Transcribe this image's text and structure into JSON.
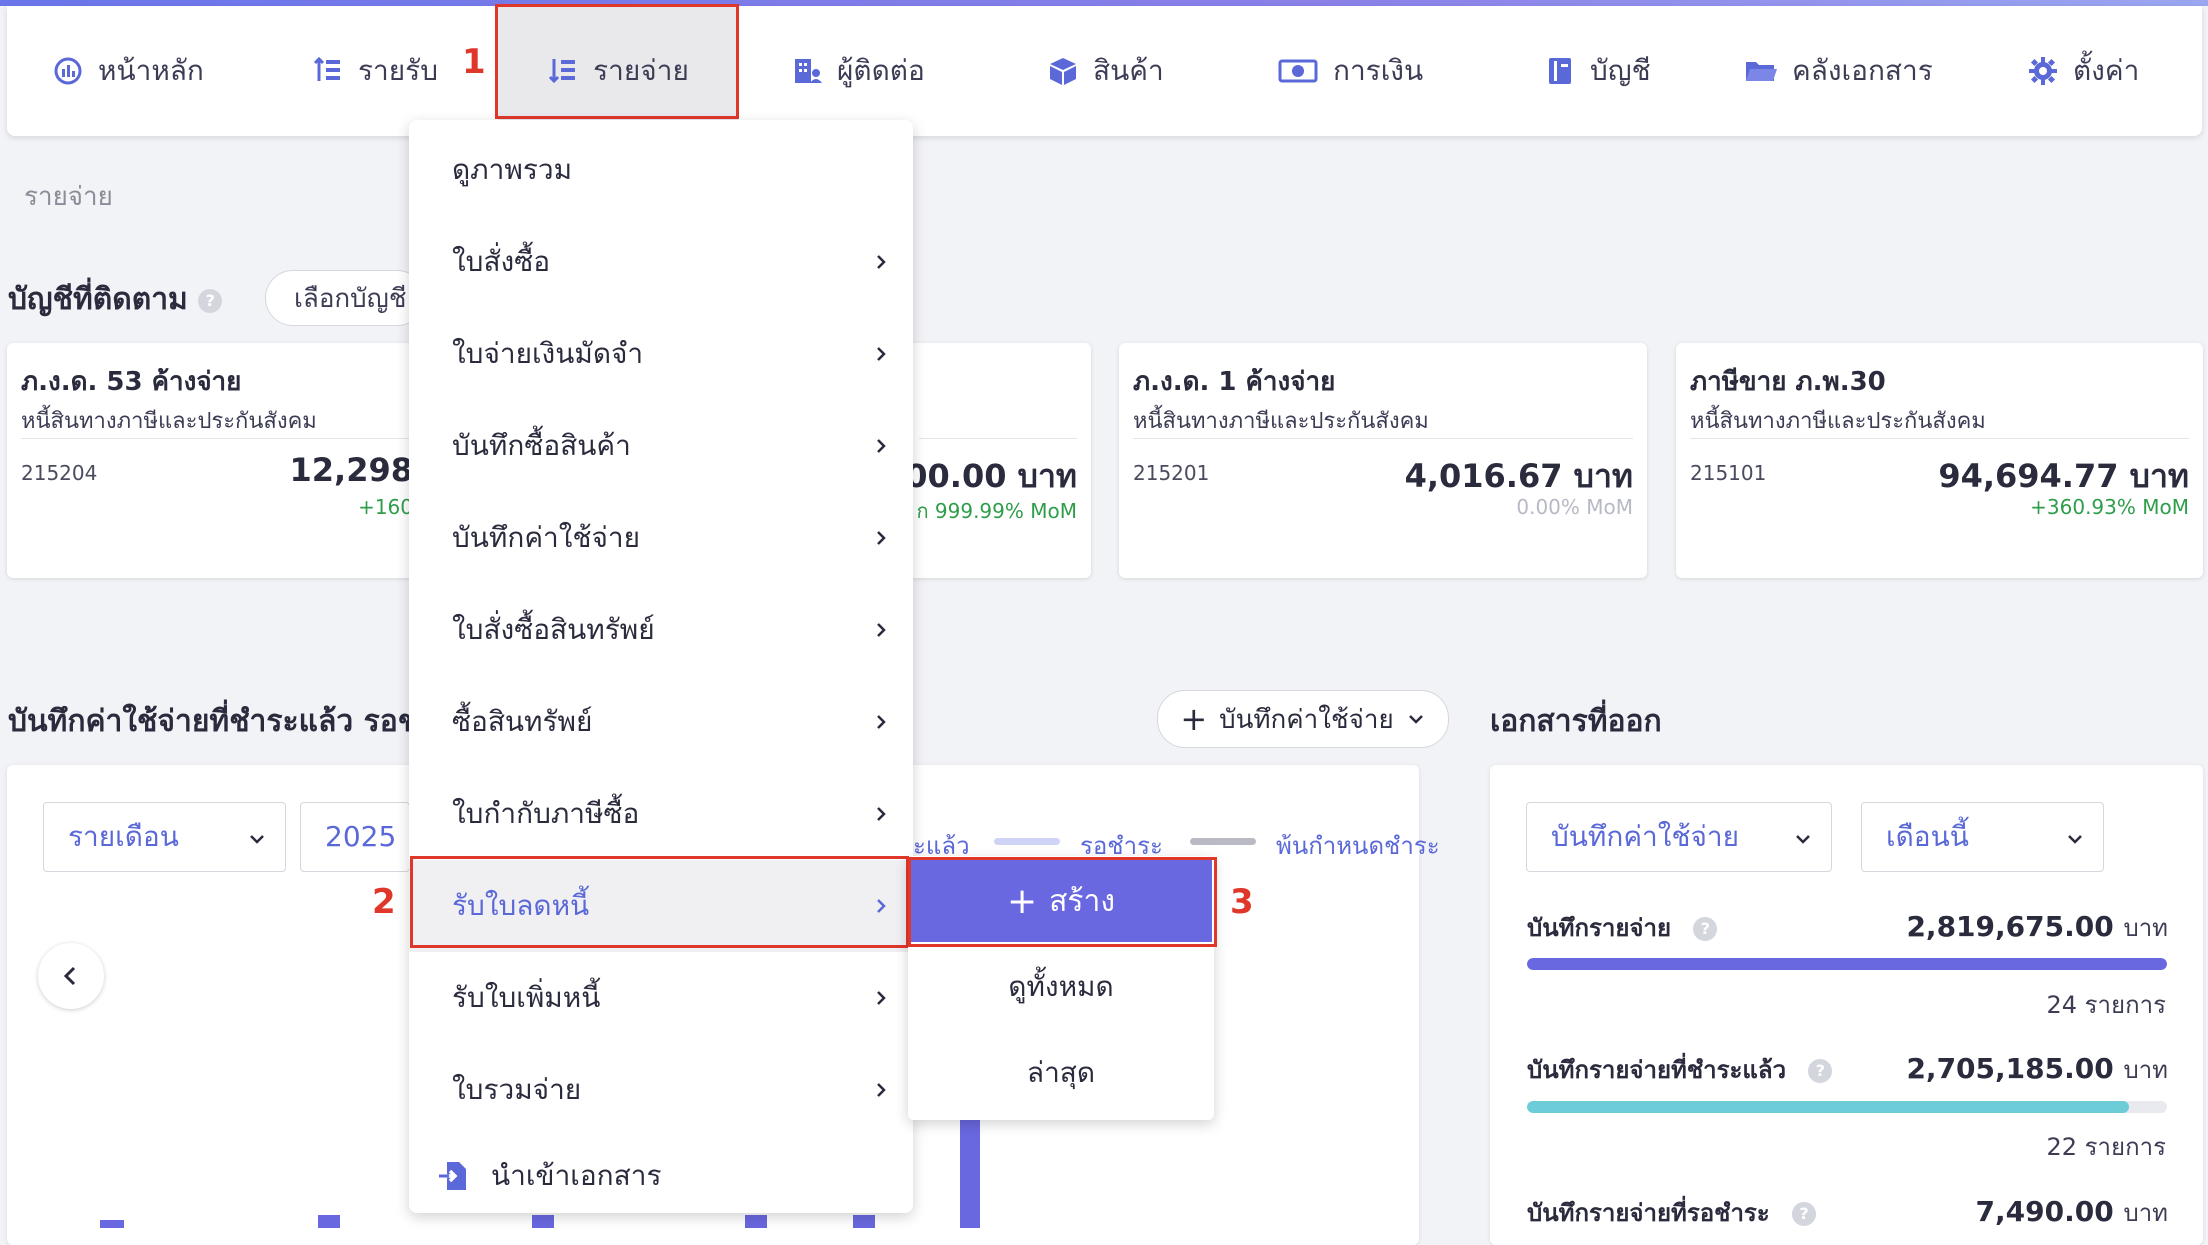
{
  "nav": {
    "items": [
      {
        "label": "หน้าหลัก",
        "icon": "dashboard-icon"
      },
      {
        "label": "รายรับ",
        "icon": "income-icon"
      },
      {
        "label": "รายจ่าย",
        "icon": "expense-icon"
      },
      {
        "label": "ผู้ติดต่อ",
        "icon": "contacts-icon"
      },
      {
        "label": "สินค้า",
        "icon": "product-box-icon"
      },
      {
        "label": "การเงิน",
        "icon": "money-icon"
      },
      {
        "label": "บัญชี",
        "icon": "ledger-book-icon"
      },
      {
        "label": "คลังเอกสาร",
        "icon": "folder-icon"
      },
      {
        "label": "ตั้งค่า",
        "icon": "gear-icon"
      }
    ],
    "active_index": 2
  },
  "steps": [
    "1",
    "2",
    "3"
  ],
  "breadcrumb": "รายจ่าย",
  "tracked": {
    "title": "บัญชีที่ติดตาม",
    "select_label": "เลือกบัญชี"
  },
  "cards": [
    {
      "title": "ภ.ง.ด. 53 ค้างจ่าย",
      "subtitle": "หนี้สินทางภาษีและประกันสังคม",
      "code": "215204",
      "amount": "12,298",
      "mom": "+160",
      "mom_color": "#2e9e4a"
    },
    {
      "title": "",
      "subtitle": "",
      "code": "",
      "amount": ",200.00 บาท",
      "mom": "ก 999.99% MoM",
      "mom_color": "#2e9e4a"
    },
    {
      "title": "ภ.ง.ด. 1 ค้างจ่าย",
      "subtitle": "หนี้สินทางภาษีและประกันสังคม",
      "code": "215201",
      "amount": "4,016.67 บาท",
      "mom": "0.00% MoM",
      "mom_color": "#b7b9c4"
    },
    {
      "title": "ภาษีขาย ภ.พ.30",
      "subtitle": "หนี้สินทางภาษีและประกันสังคม",
      "code": "215101",
      "amount": "94,694.77 บาท",
      "mom": "+360.93% MoM",
      "mom_color": "#2e9e4a"
    }
  ],
  "expense_section": {
    "title": "บันทึกค่าใช้จ่ายที่ชำระแล้ว รอชำ",
    "add_button": "บันทึกค่าใช้จ่าย",
    "period_select": "รายเดือน",
    "year_select": "2025",
    "legend": [
      {
        "label": "ะแล้ว",
        "color": "#6a68e0"
      },
      {
        "label": "รอชำระ",
        "color": "#cfd3f5"
      },
      {
        "label": "พ้นกำหนดชำระ",
        "color": "#b9bac4"
      }
    ]
  },
  "dropdown": {
    "items": [
      {
        "label": "ดูภาพรวม",
        "arrow": false
      },
      {
        "label": "ใบสั่งซื้อ",
        "arrow": true
      },
      {
        "label": "ใบจ่ายเงินมัดจำ",
        "arrow": true
      },
      {
        "label": "บันทึกซื้อสินค้า",
        "arrow": true
      },
      {
        "label": "บันทึกค่าใช้จ่าย",
        "arrow": true
      },
      {
        "label": "ใบสั่งซื้อสินทรัพย์",
        "arrow": true
      },
      {
        "label": "ซื้อสินทรัพย์",
        "arrow": true
      },
      {
        "label": "ใบกำกับภาษีซื้อ",
        "arrow": true
      },
      {
        "label": "รับใบลดหนี้",
        "arrow": true
      },
      {
        "label": "รับใบเพิ่มหนี้",
        "arrow": true
      },
      {
        "label": "ใบรวมจ่าย",
        "arrow": true
      }
    ],
    "import_label": "นำเข้าเอกสาร",
    "highlighted_index": 8
  },
  "submenu": {
    "create": "สร้าง",
    "view_all": "ดูทั้งหมด",
    "latest": "ล่าสุด"
  },
  "issued_docs": {
    "title": "เอกสารที่ออก",
    "type_select": "บันทึกค่าใช้จ่าย",
    "month_select": "เดือนนี้",
    "stats": [
      {
        "label": "บันทึกรายจ่าย",
        "amount": "2,819,675.00",
        "unit": "บาท",
        "count": "24 รายการ",
        "color": "#6a68e0",
        "fraction": 1.0
      },
      {
        "label": "บันทึกรายจ่ายที่ชำระแล้ว",
        "amount": "2,705,185.00",
        "unit": "บาท",
        "count": "22 รายการ",
        "color": "#6cccd8",
        "fraction": 0.94
      },
      {
        "label": "บันทึกรายจ่ายที่รอชำระ",
        "amount": "7,490.00",
        "unit": "บาท",
        "count": "",
        "color": "#cfd3f5",
        "fraction": 0.003
      }
    ]
  }
}
